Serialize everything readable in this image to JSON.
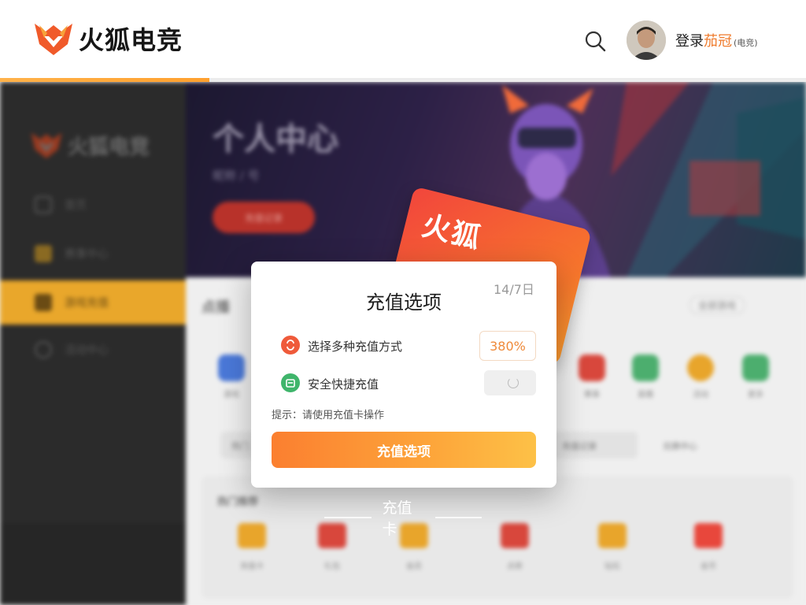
{
  "header": {
    "brand_name": "火狐电竞",
    "search_icon": "search-icon",
    "login_prefix": "登录",
    "login_highlight": "茄冠",
    "login_suffix": "(电竞)",
    "progress_fraction": 0.26,
    "accent_color": "#ffa02e"
  },
  "background": {
    "sidebar": {
      "brand_name": "火狐电竞",
      "items": [
        {
          "label": "首页",
          "icon": "home-icon",
          "active": false
        },
        {
          "label": "赛事中心",
          "icon": "trophy-icon",
          "active": false
        },
        {
          "label": "游戏充值",
          "icon": "wallet-icon",
          "active": true
        },
        {
          "label": "活动中心",
          "icon": "refresh-icon",
          "active": false
        }
      ],
      "active_color": "#e9a72b"
    },
    "banner": {
      "title": "个人中心",
      "subtitle": "昵称 / 号",
      "button_label": "充值记录"
    },
    "section": {
      "title": "点播",
      "filter_label": "全部游戏"
    },
    "icon_row": [
      {
        "label": "游戏",
        "color": "#4a78d8"
      },
      {
        "label": "赛事",
        "color": "#d8473c"
      },
      {
        "label": "直播",
        "color": "#4cae6e"
      },
      {
        "label": "活动",
        "color": "#e8a52b"
      },
      {
        "label": "更多",
        "color": "#4cae6e"
      }
    ],
    "pills": [
      "热门",
      "充值记录",
      "兑换中心"
    ],
    "grid": {
      "title": "热门推荐",
      "items": [
        {
          "label": "充值卡",
          "color": "#e8a52b"
        },
        {
          "label": "礼包",
          "color": "#d8473c"
        },
        {
          "label": "会员",
          "color": "#e8a52b"
        },
        {
          "label": "点券",
          "color": "#d8473c"
        },
        {
          "label": "钻石",
          "color": "#e8a52b"
        },
        {
          "label": "金币",
          "color": "#e8473c"
        }
      ]
    }
  },
  "gift_card": {
    "title": "火狐"
  },
  "dialog": {
    "title": "充值选项",
    "badge": "14/7日",
    "options": [
      {
        "label": "选择多种充值方式",
        "icon": "recharge-icon",
        "icon_color": "#ef5a3a",
        "value": "380%"
      },
      {
        "label": "安全快捷充值",
        "icon": "calendar-icon",
        "icon_color": "#3fb56b"
      }
    ],
    "note": "提示：请使用充值卡操作",
    "button_label": "充值选项"
  },
  "caption": {
    "text": "充值卡"
  }
}
